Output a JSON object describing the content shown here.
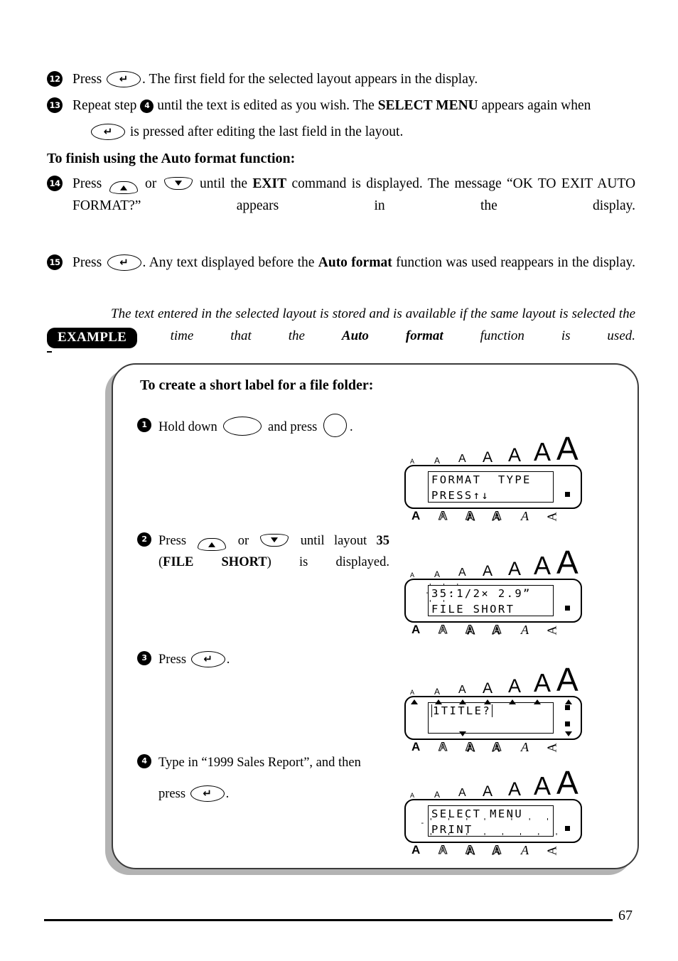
{
  "document": {
    "page_number": "67",
    "example_badge": "EXAMPLE"
  },
  "steps_top": [
    {
      "number": "12",
      "text_before": "Press",
      "key": "enter-key",
      "text_after": ". The first field for the selected layout appears in the display."
    },
    {
      "number": "13",
      "text_a": "Repeat step",
      "inline_num": "4",
      "text_b": "until the text is edited as you wish. The",
      "bold": "SELECT MENU",
      "text_c": "appears again when",
      "text_d": "is pressed after editing the last field in the layout."
    }
  ],
  "section_heading": "To finish using the Auto format function:",
  "steps_bottom": [
    {
      "number": "14",
      "text_a": "Press",
      "key_up": "up-arrow-key",
      "or": "or",
      "key_down": "down-arrow-key",
      "text_b": "until the",
      "bold_b": "EXIT",
      "text_c": "command is displayed. The message “OK TO EXIT AUTO FORMAT?” appears in the display."
    },
    {
      "number": "15",
      "text_a": "Press",
      "key": "enter-key",
      "text_b": ". Any text displayed before the",
      "bold_b": "Auto format",
      "text_c": "function was used reappears in the display."
    }
  ],
  "note": {
    "text_a": "The text entered in the selected layout is stored and is available if the same layout is selected the next time that the",
    "bold": "Auto format",
    "text_b": "function is used."
  },
  "example": {
    "title": "To create a short label for a file folder:",
    "steps": [
      {
        "number": "1",
        "text_a": "Hold down",
        "key_a": "oval-blank-key",
        "text_b": "and press",
        "key_b": "circle-blank-key",
        "text_c": "."
      },
      {
        "number": "2",
        "text_a": "Press",
        "key_up": "up-arrow-key",
        "or": "or",
        "key_down": "down-arrow-key",
        "text_b": "until layout",
        "bold_b": "35",
        "text_c": "(",
        "bold_c": "FILE SHORT",
        "text_d": ") is displayed."
      },
      {
        "number": "3",
        "text_a": "Press",
        "key": "enter-key",
        "text_b": "."
      },
      {
        "number": "4",
        "text_a": "Type in “1999 Sales Report”, and then",
        "text_b": "press",
        "key": "enter-key",
        "text_c": "."
      }
    ]
  },
  "lcd_displays": [
    {
      "id": "lcd-1",
      "line1": "FORMAT  TYPE",
      "line2": "PRESS↑↓",
      "size_indicators": [
        "A",
        "A",
        "A",
        "A",
        "A",
        "A",
        "A"
      ],
      "style_indicators": [
        "A",
        "A",
        "A",
        "A",
        "A",
        "A"
      ],
      "right_square": true
    },
    {
      "id": "lcd-2",
      "line1": "35:1/2× 2.9”",
      "line2": "FILE SHORT",
      "blinking_field": "35",
      "size_indicators": [
        "A",
        "A",
        "A",
        "A",
        "A",
        "A",
        "A"
      ],
      "style_indicators": [
        "A",
        "A",
        "A",
        "A",
        "A",
        "A"
      ],
      "right_square": true
    },
    {
      "id": "lcd-3",
      "line1": "1TITLE?",
      "line2": "_",
      "size_indicators": [
        "A",
        "A",
        "A",
        "A",
        "A",
        "A",
        "A"
      ],
      "style_indicators": [
        "A",
        "A",
        "A",
        "A",
        "A",
        "A"
      ],
      "markers_up": 7,
      "markers_down": 5,
      "right_squares": 2
    },
    {
      "id": "lcd-4",
      "line1": "SELECT MENU",
      "line2": "PRINT",
      "blinking_all": true,
      "size_indicators": [
        "A",
        "A",
        "A",
        "A",
        "A",
        "A",
        "A"
      ],
      "style_indicators": [
        "A",
        "A",
        "A",
        "A",
        "A",
        "A"
      ],
      "right_square": true
    }
  ]
}
